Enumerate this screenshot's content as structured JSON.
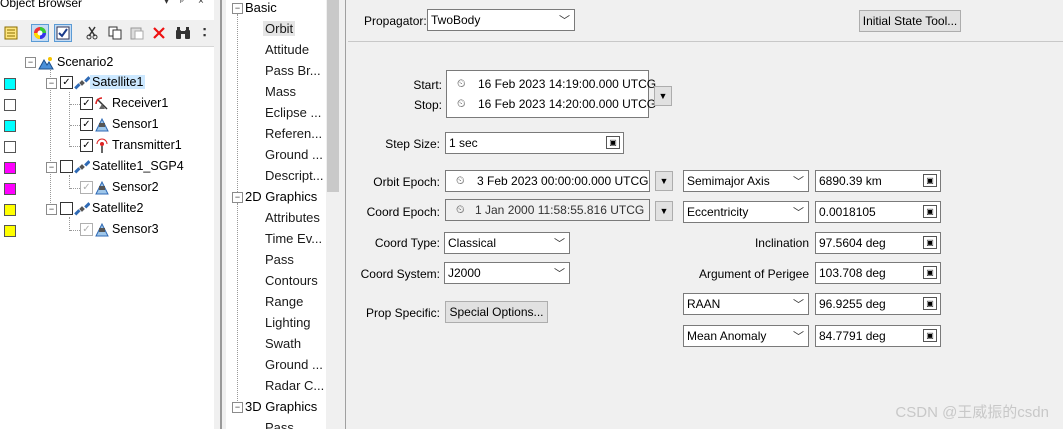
{
  "browser": {
    "title": "Object Browser",
    "header_buttons": [
      "▾",
      "ᵖ",
      "×"
    ],
    "tree": [
      {
        "label": "Scenario2"
      },
      {
        "label": "Satellite1"
      },
      {
        "label": "Receiver1"
      },
      {
        "label": "Sensor1"
      },
      {
        "label": "Transmitter1"
      },
      {
        "label": "Satellite1_SGP4"
      },
      {
        "label": "Sensor2"
      },
      {
        "label": "Satellite2"
      },
      {
        "label": "Sensor3"
      }
    ],
    "swatch_colors": [
      "#00ffff",
      "#ffffff",
      "#00ffff",
      "#ffffff",
      "#ff00ff",
      "#ff00ff",
      "#ffff00",
      "#ffff00"
    ]
  },
  "pagelist": {
    "categories": [
      "Basic",
      "2D Graphics",
      "3D Graphics"
    ],
    "basic_items": [
      "Orbit",
      "Attitude",
      "Pass Br...",
      "Mass",
      "Eclipse ...",
      "Referen...",
      "Ground ...",
      "Descript..."
    ],
    "graphics2d_items": [
      "Attributes",
      "Time Ev...",
      "Pass",
      "Contours",
      "Range",
      "Lighting",
      "Swath",
      "Ground ...",
      "Radar C..."
    ],
    "graphics3d_items": [
      "Pass"
    ]
  },
  "props": {
    "propagator_label": "Propagator:",
    "propagator_value": "TwoBody",
    "initial_state_button": "Initial State Tool...",
    "start_label": "Start:",
    "start_value": "16 Feb 2023 14:19:00.000 UTCG",
    "stop_label": "Stop:",
    "stop_value": "16 Feb 2023 14:20:00.000 UTCG",
    "step_label": "Step Size:",
    "step_value": "1 sec",
    "orbit_epoch_label": "Orbit Epoch:",
    "orbit_epoch_value": "3 Feb 2023 00:00:00.000 UTCG",
    "coord_epoch_label": "Coord Epoch:",
    "coord_epoch_value": "1 Jan 2000 11:58:55.816 UTCG",
    "coord_type_label": "Coord Type:",
    "coord_type_value": "Classical",
    "coord_system_label": "Coord System:",
    "coord_system_value": "J2000",
    "prop_specific_label": "Prop Specific:",
    "special_options_button": "Special Options...",
    "elements": [
      {
        "name": "Semimajor Axis",
        "type": "combo",
        "value": "6890.39 km"
      },
      {
        "name": "Eccentricity",
        "type": "combo",
        "value": "0.0018105"
      },
      {
        "name": "Inclination",
        "type": "label",
        "value": "97.5604 deg"
      },
      {
        "name": "Argument of Perigee",
        "type": "label",
        "value": "103.708 deg"
      },
      {
        "name": "RAAN",
        "type": "combo",
        "value": "96.9255 deg"
      },
      {
        "name": "Mean Anomaly",
        "type": "combo",
        "value": "84.7791 deg"
      }
    ]
  },
  "watermark": "CSDN @王威振的csdn",
  "colors": {
    "selection": "#cce8ff",
    "panel": "#f0f0f0"
  }
}
